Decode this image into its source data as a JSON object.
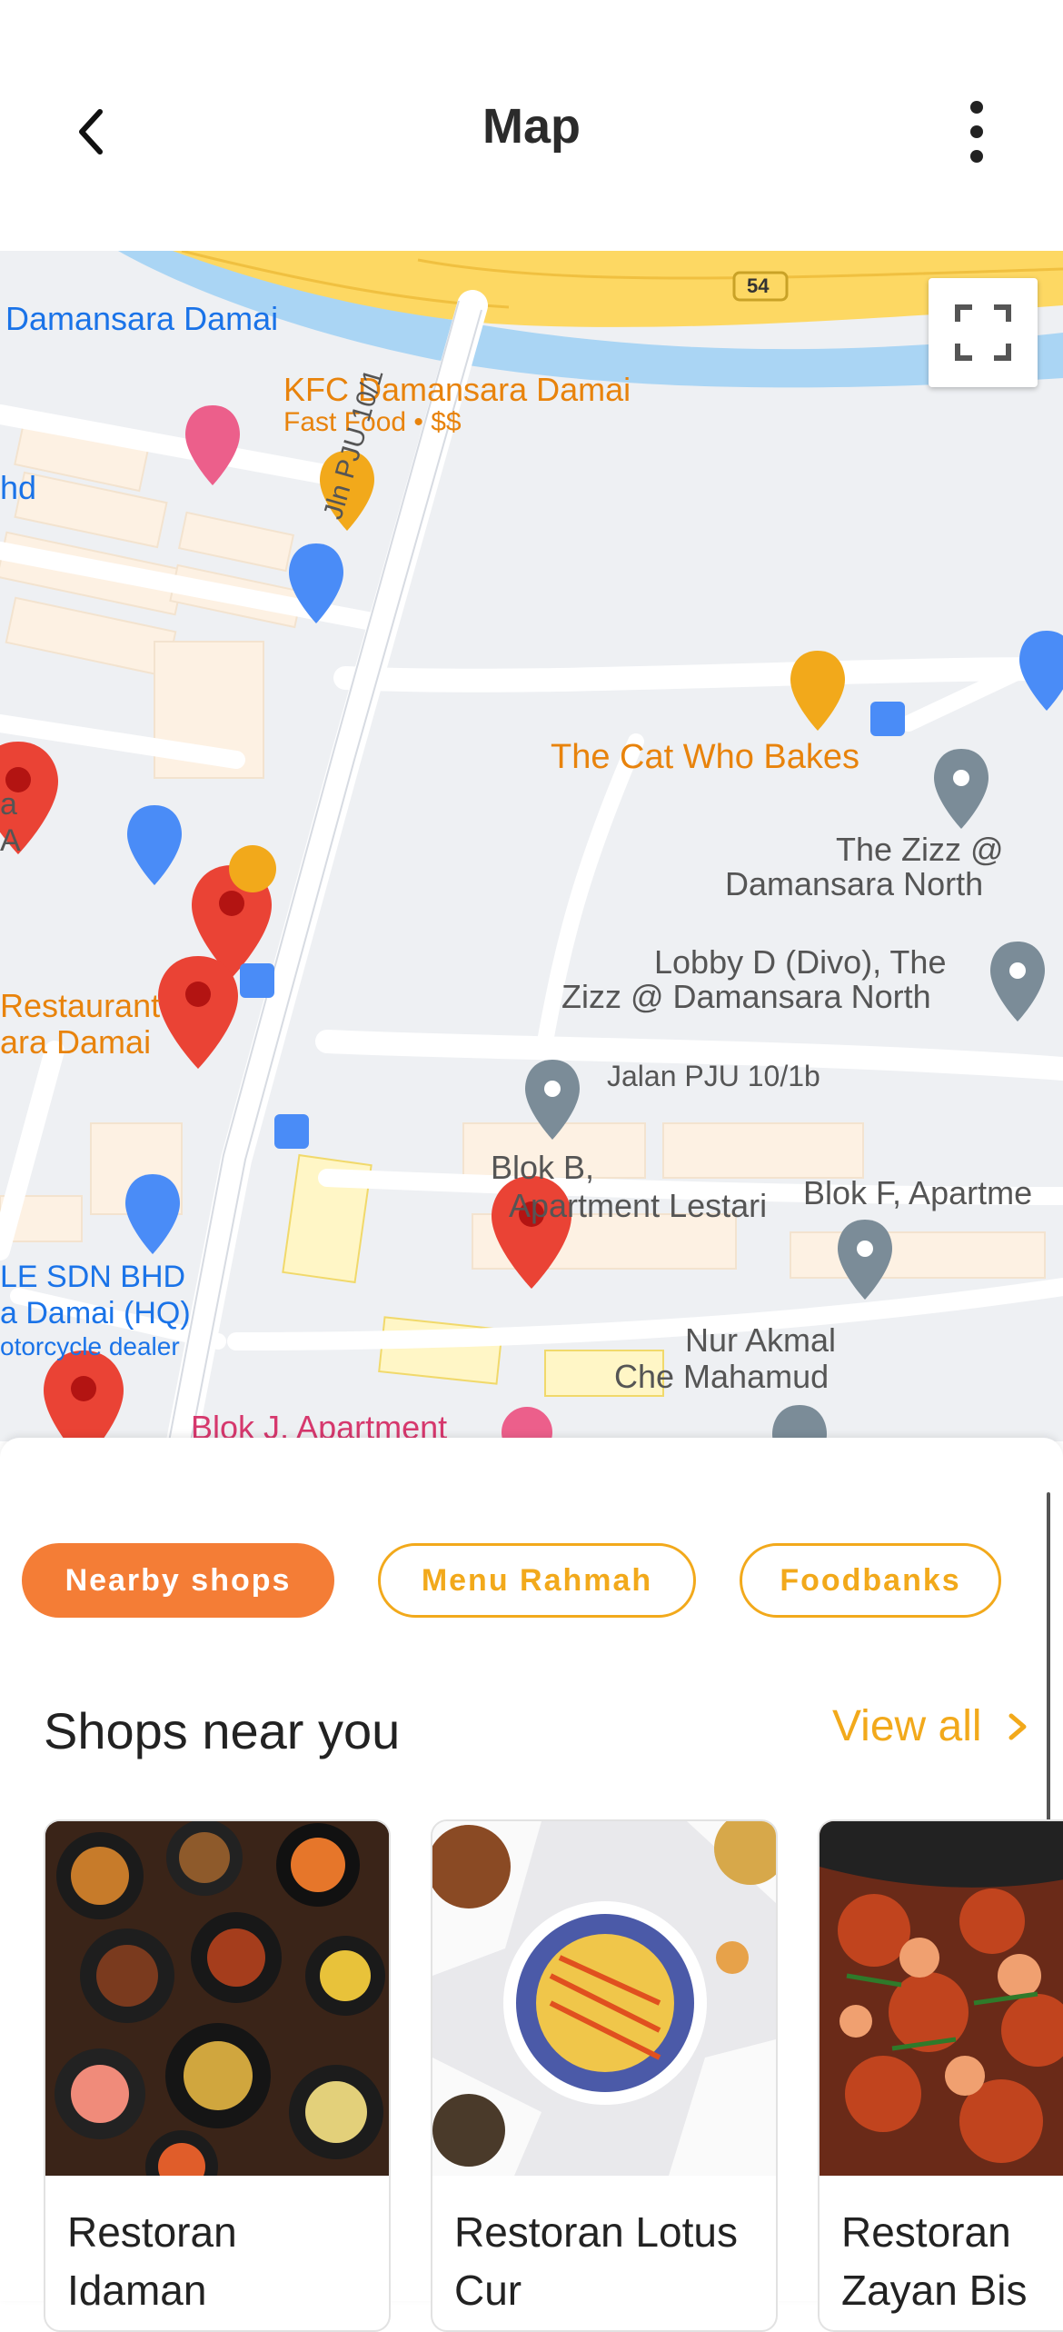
{
  "header": {
    "title": "Map",
    "back_icon": "chevron-left-icon",
    "more_icon": "more-vertical-icon"
  },
  "map": {
    "labels": {
      "damansara_damai": "Damansara Damai",
      "kfc": "KFC Damansara Damai",
      "kfc_sub": "Fast Food • $$",
      "hd": "hd",
      "road_jln": "Jln PJU 10/1",
      "cat_bakes": "The Cat Who Bakes",
      "zizz1": "The Zizz @",
      "zizz2": "Damansara North",
      "lobby1": "Lobby D (Divo), The",
      "lobby2": "Zizz @ Damansara North",
      "jalan": "Jalan PJU 10/1b",
      "blokb1": "Blok B,",
      "blokb2": "Apartment Lestari",
      "blokf": "Blok F, Apartme",
      "restaurant1": "Restaurant",
      "restaurant2": "ara Damai",
      "a1": "a",
      "a2": "A",
      "cle1": "LE SDN BHD",
      "cle2": "a Damai (HQ)",
      "cle3": "otorcycle dealer",
      "nur1": "Nur Akmal",
      "nur2": "Che Mahamud",
      "blokj": "Blok J, Apartment",
      "highway": "54"
    },
    "fullscreen_icon": "fullscreen-icon"
  },
  "chips": [
    {
      "label": "Nearby shops",
      "active": true
    },
    {
      "label": "Menu Rahmah",
      "active": false
    },
    {
      "label": "Foodbanks",
      "active": false
    }
  ],
  "section": {
    "title": "Shops near you",
    "view_all": "View all"
  },
  "shops": [
    {
      "name": "Restoran Idaman"
    },
    {
      "name": "Restoran Lotus Cur"
    },
    {
      "name": "Restoran Zayan Bis"
    }
  ],
  "colors": {
    "accent": "#f47d36",
    "accent_yellow": "#f2a91b",
    "map_orange_label": "#e8830c",
    "map_blue_label": "#1a73e8",
    "pin_red": "#ea4335"
  }
}
